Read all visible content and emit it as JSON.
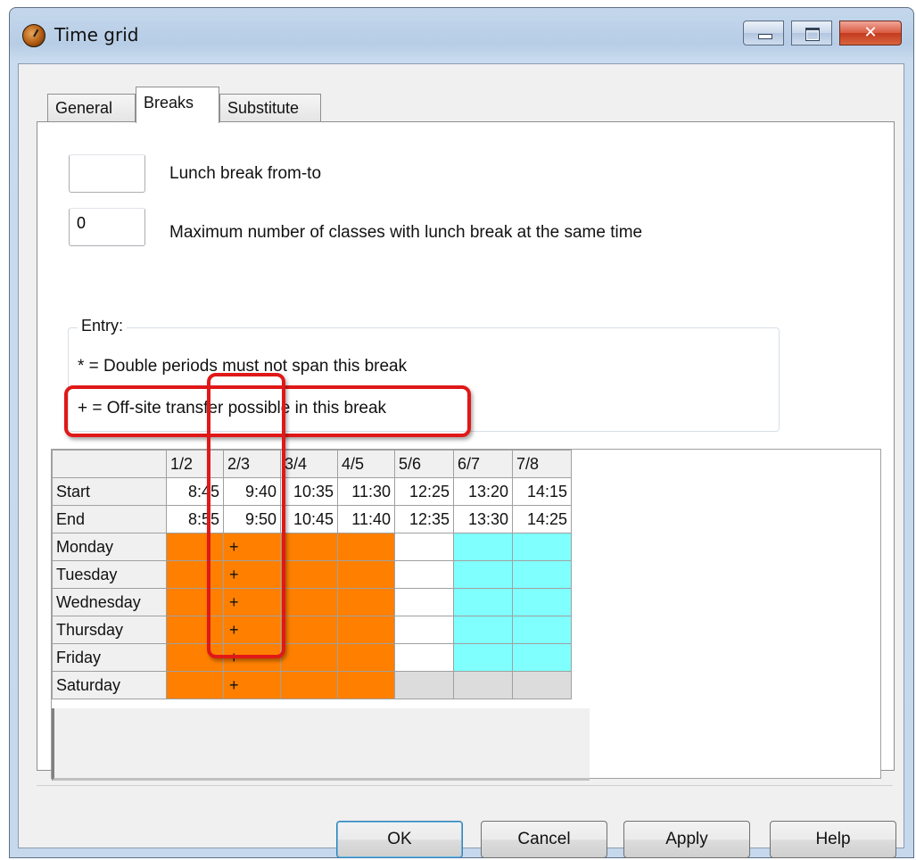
{
  "window": {
    "title": "Time grid",
    "close_glyph": "✕"
  },
  "tabs": [
    {
      "label": "General",
      "active": false
    },
    {
      "label": "Breaks",
      "active": true
    },
    {
      "label": "Substitute",
      "active": false
    }
  ],
  "breaks": {
    "lunch_value": "",
    "lunch_label": "Lunch break from-to",
    "max_value": "0",
    "max_label": "Maximum number of classes with lunch break at the same time",
    "entry_title": "Entry:",
    "entry_double": "* = Double periods must not span this break",
    "entry_offsite": "+ = Off-site transfer possible in this break"
  },
  "grid": {
    "columns": [
      "1/2",
      "2/3",
      "3/4",
      "4/5",
      "5/6",
      "6/7",
      "7/8"
    ],
    "start_label": "Start",
    "end_label": "End",
    "start_times": [
      "8:45",
      "9:40",
      "10:35",
      "11:30",
      "12:25",
      "13:20",
      "14:15"
    ],
    "end_times": [
      "8:55",
      "9:50",
      "10:45",
      "11:40",
      "12:35",
      "13:30",
      "14:25"
    ],
    "days": [
      {
        "name": "Monday",
        "cells": [
          "",
          "+",
          "",
          "",
          "",
          "",
          ""
        ],
        "colors": [
          "orange",
          "orange",
          "orange",
          "orange",
          "white",
          "cyan",
          "cyan"
        ]
      },
      {
        "name": "Tuesday",
        "cells": [
          "",
          "+",
          "",
          "",
          "",
          "",
          ""
        ],
        "colors": [
          "orange",
          "orange",
          "orange",
          "orange",
          "white",
          "cyan",
          "cyan"
        ]
      },
      {
        "name": "Wednesday",
        "cells": [
          "",
          "+",
          "",
          "",
          "",
          "",
          ""
        ],
        "colors": [
          "orange",
          "orange",
          "orange",
          "orange",
          "white",
          "cyan",
          "cyan"
        ]
      },
      {
        "name": "Thursday",
        "cells": [
          "",
          "+",
          "",
          "",
          "",
          "",
          ""
        ],
        "colors": [
          "orange",
          "orange",
          "orange",
          "orange",
          "white",
          "cyan",
          "cyan"
        ]
      },
      {
        "name": "Friday",
        "cells": [
          "",
          "+",
          "",
          "",
          "",
          "",
          ""
        ],
        "colors": [
          "orange",
          "orange",
          "orange",
          "orange",
          "white",
          "cyan",
          "cyan"
        ]
      },
      {
        "name": "Saturday",
        "cells": [
          "",
          "+",
          "",
          "",
          "",
          "",
          ""
        ],
        "colors": [
          "orange",
          "orange",
          "orange",
          "orange",
          "gray",
          "gray",
          "gray"
        ]
      }
    ],
    "palette": {
      "orange": "#ff8000",
      "white": "#ffffff",
      "cyan": "#80ffff",
      "gray": "#dcdcdc"
    }
  },
  "buttons": {
    "ok": "OK",
    "cancel": "Cancel",
    "apply": "Apply",
    "help": "Help"
  },
  "highlight_color": "#e01818"
}
